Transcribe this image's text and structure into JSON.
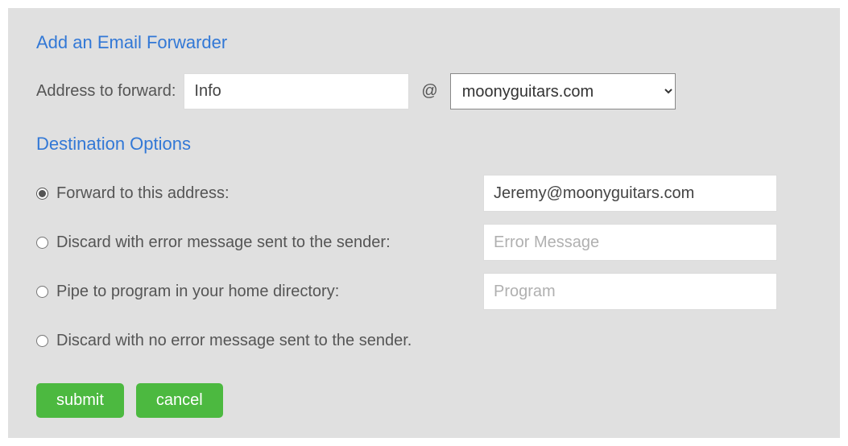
{
  "headings": {
    "add_forwarder": "Add an Email Forwarder",
    "destination_options": "Destination Options"
  },
  "address": {
    "label": "Address to forward:",
    "value": "Info",
    "at": "@",
    "domain_selected": "moonyguitars.com"
  },
  "options": {
    "forward": {
      "label": "Forward to this address:",
      "value": "Jeremy@moonyguitars.com"
    },
    "discard_error": {
      "label": "Discard with error message sent to the sender:",
      "placeholder": "Error Message"
    },
    "pipe": {
      "label": "Pipe to program in your home directory:",
      "placeholder": "Program"
    },
    "discard_noerror": {
      "label": "Discard with no error message sent to the sender."
    }
  },
  "buttons": {
    "submit": "submit",
    "cancel": "cancel"
  }
}
